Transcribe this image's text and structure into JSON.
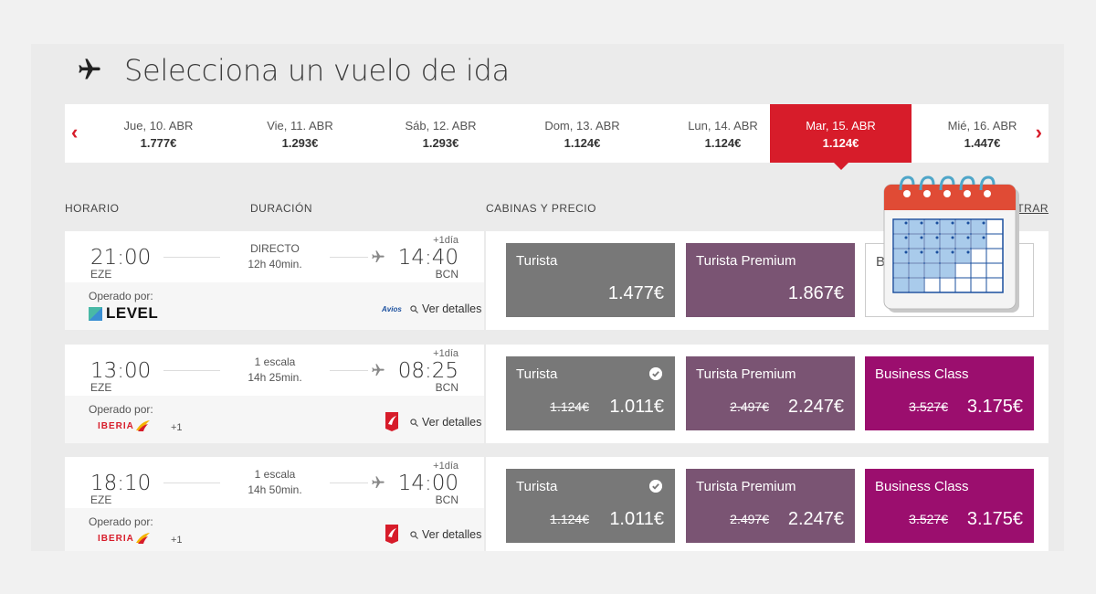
{
  "page": {
    "title": "Selecciona un vuelo de ida"
  },
  "dates": [
    {
      "day": "Jue, 10. ABR",
      "price": "1.777€",
      "selected": false
    },
    {
      "day": "Vie, 11. ABR",
      "price": "1.293€",
      "selected": false
    },
    {
      "day": "Sáb, 12. ABR",
      "price": "1.293€",
      "selected": false
    },
    {
      "day": "Dom, 13. ABR",
      "price": "1.124€",
      "selected": false
    },
    {
      "day": "Lun, 14. ABR",
      "price": "1.124€",
      "selected": false
    },
    {
      "day": "Mar, 15. ABR",
      "price": "1.124€",
      "selected": true
    },
    {
      "day": "Mié, 16. ABR",
      "price": "1.447€",
      "selected": false
    }
  ],
  "columns": {
    "schedule": "HORARIO",
    "duration": "DURACIÓN",
    "cabins": "CABINAS Y PRECIO",
    "filter_partial": "TRAR"
  },
  "flights": [
    {
      "dep_time": "21:00",
      "dep_code": "EZE",
      "arr_time": "14:40",
      "arr_code": "BCN",
      "plus_day": "+1día",
      "stops": "DIRECTO",
      "duration": "12h 40min.",
      "operated_by": "Operado por:",
      "airline": "LEVEL",
      "details": "Ver detalles",
      "fares": [
        {
          "cabin": "Turista",
          "price": "1.477€"
        },
        {
          "cabin": "Turista Premium",
          "price": "1.867€"
        },
        {
          "cabin": "B",
          "price": ""
        }
      ]
    },
    {
      "dep_time": "13:00",
      "dep_code": "EZE",
      "arr_time": "08:25",
      "arr_code": "BCN",
      "plus_day": "+1día",
      "stops": "1 escala",
      "duration": "14h 25min.",
      "operated_by": "Operado por:",
      "airline": "IBERIA",
      "extra": "+1",
      "details": "Ver detalles",
      "fares": [
        {
          "cabin": "Turista",
          "old_price": "1.124€",
          "price": "1.011€"
        },
        {
          "cabin": "Turista Premium",
          "old_price": "2.497€",
          "price": "2.247€"
        },
        {
          "cabin": "Business Class",
          "old_price": "3.527€",
          "price": "3.175€"
        }
      ]
    },
    {
      "dep_time": "18:10",
      "dep_code": "EZE",
      "arr_time": "14:00",
      "arr_code": "BCN",
      "plus_day": "+1día",
      "stops": "1 escala",
      "duration": "14h 50min.",
      "operated_by": "Operado por:",
      "airline": "IBERIA",
      "extra": "+1",
      "details": "Ver detalles",
      "fares": [
        {
          "cabin": "Turista",
          "old_price": "1.124€",
          "price": "1.011€"
        },
        {
          "cabin": "Turista Premium",
          "old_price": "2.497€",
          "price": "2.247€"
        },
        {
          "cabin": "Business Class",
          "old_price": "3.527€",
          "price": "3.175€"
        }
      ]
    }
  ],
  "colors": {
    "accent": "#d71c2a",
    "turista": "#787878",
    "premium": "#7a5473",
    "business": "#9b0e6e"
  },
  "icons": [
    "plane-icon",
    "chevron-left-icon",
    "chevron-right-icon",
    "magnifier-icon",
    "check-icon",
    "calendar-icon"
  ]
}
